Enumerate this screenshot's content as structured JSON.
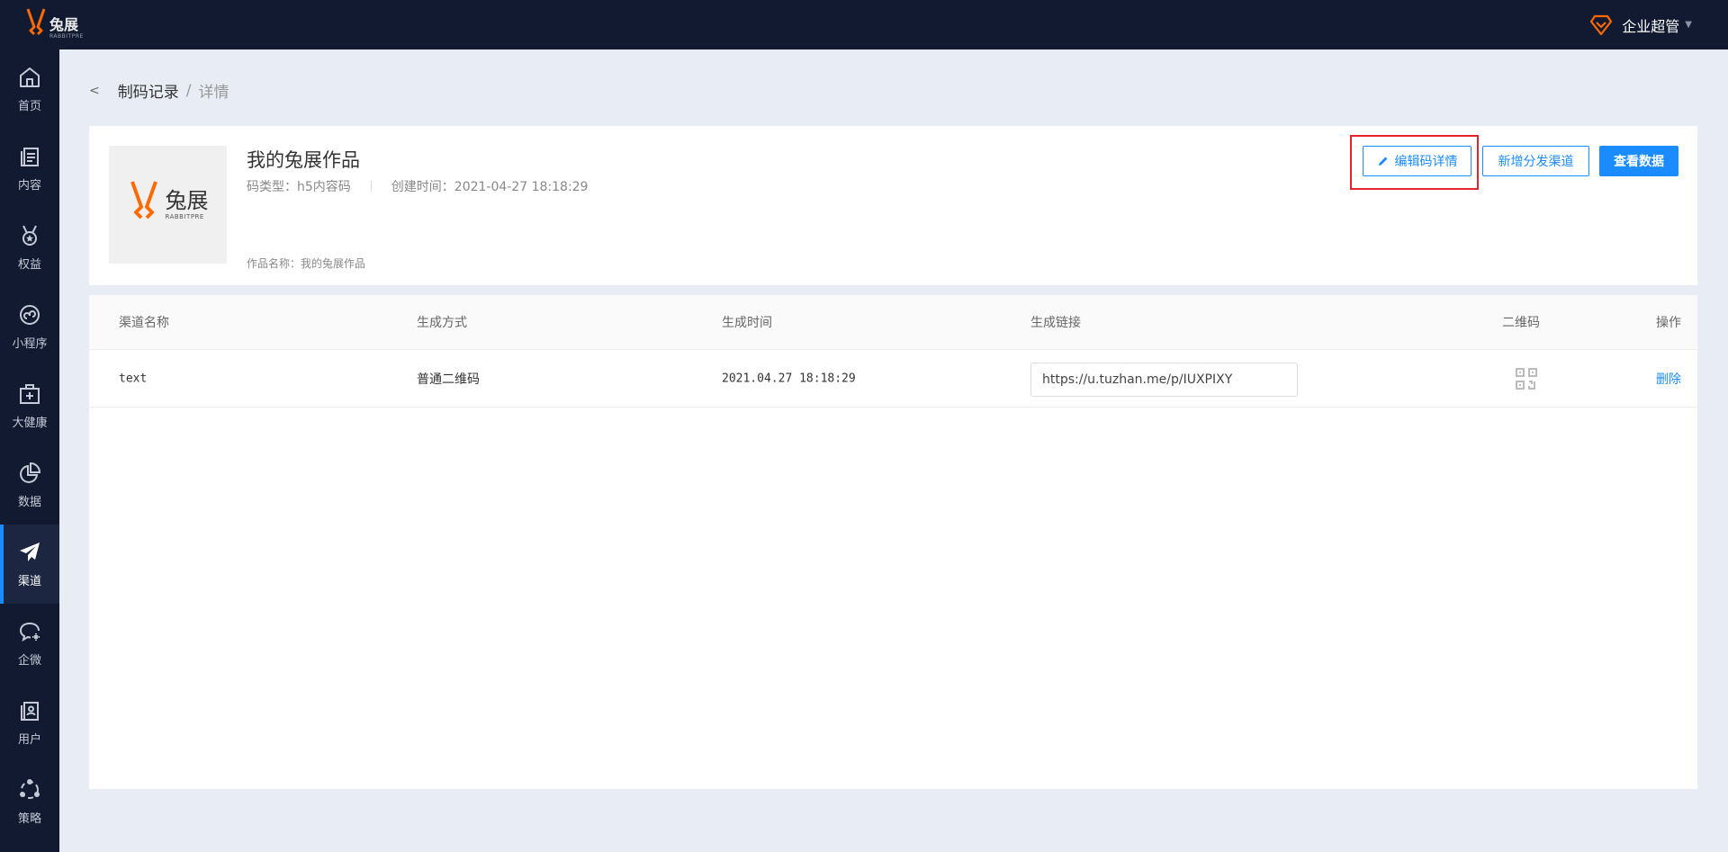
{
  "header": {
    "logo_cn": "兔展",
    "logo_en": "RABBITPRE",
    "user_name": "企业超管"
  },
  "sidebar": {
    "items": [
      {
        "label": "首页",
        "icon": "home-icon"
      },
      {
        "label": "内容",
        "icon": "document-icon"
      },
      {
        "label": "权益",
        "icon": "medal-icon"
      },
      {
        "label": "小程序",
        "icon": "miniprogram-icon"
      },
      {
        "label": "大健康",
        "icon": "medical-kit-icon"
      },
      {
        "label": "数据",
        "icon": "pie-chart-icon"
      },
      {
        "label": "渠道",
        "icon": "paper-plane-icon",
        "active": true
      },
      {
        "label": "企微",
        "icon": "chat-icon"
      },
      {
        "label": "用户",
        "icon": "user-card-icon"
      },
      {
        "label": "策略",
        "icon": "strategy-icon"
      }
    ]
  },
  "breadcrumb": {
    "parent": "制码记录",
    "separator": "/",
    "current": "详情"
  },
  "info": {
    "thumb_cn": "兔展",
    "thumb_en": "RABBITPRE",
    "title": "我的兔展作品",
    "code_type": "码类型：h5内容码",
    "created": "创建时间：2021-04-27 18:18:29",
    "work_name": "作品名称：我的兔展作品",
    "edit_label": "编辑码详情",
    "add_label": "新增分发渠道",
    "data_label": "查看数据"
  },
  "table": {
    "headers": [
      "渠道名称",
      "生成方式",
      "生成时间",
      "生成链接",
      "二维码",
      "操作"
    ],
    "rows": [
      {
        "channel": "text",
        "method": "普通二维码",
        "time": "2021.04.27 18:18:29",
        "link": "https://u.tuzhan.me/p/IUXPIXY",
        "action": "删除"
      }
    ]
  },
  "colors": {
    "accent": "#1a8cff",
    "highlight": "#e8232c",
    "brand": "#ff6a00",
    "topbar": "#111a30"
  }
}
